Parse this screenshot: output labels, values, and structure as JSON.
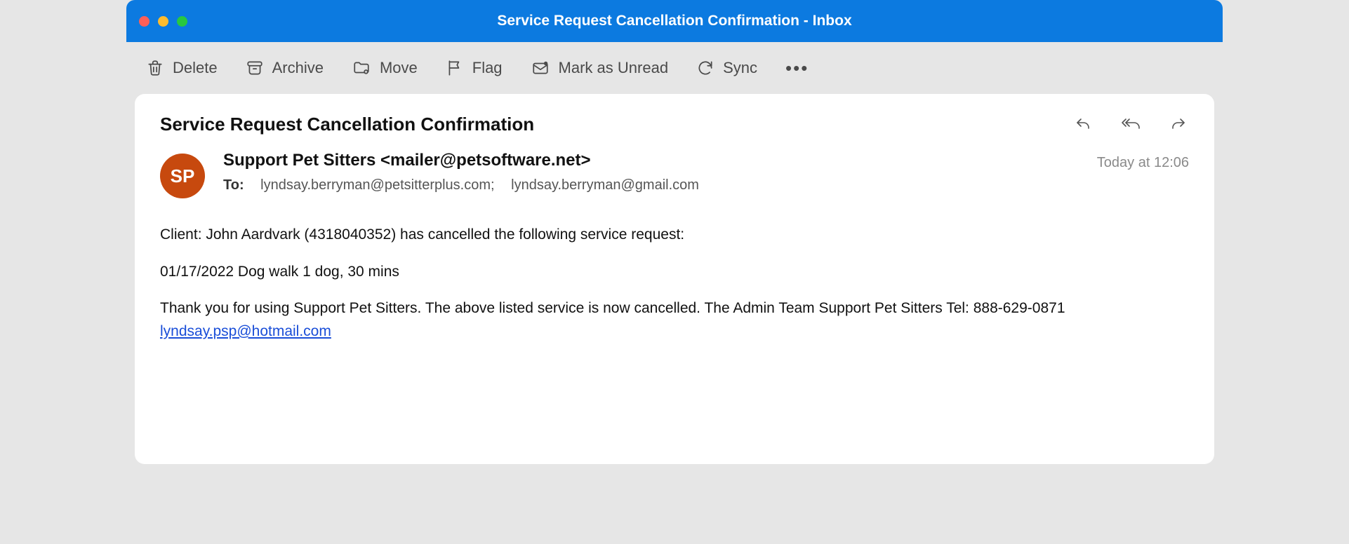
{
  "window": {
    "title": "Service Request Cancellation Confirmation - Inbox"
  },
  "toolbar": {
    "delete": "Delete",
    "archive": "Archive",
    "move": "Move",
    "flag": "Flag",
    "mark_unread": "Mark as Unread",
    "sync": "Sync"
  },
  "message": {
    "subject": "Service Request Cancellation Confirmation",
    "sender_display": "Support Pet Sitters <mailer@petsoftware.net>",
    "avatar_initials": "SP",
    "to_label": "To:",
    "recipients": [
      "lyndsay.berryman@petsitterplus.com;",
      "lyndsay.berryman@gmail.com"
    ],
    "timestamp": "Today at 12:06",
    "body": {
      "line1": "Client: John Aardvark (4318040352) has cancelled the following service request:",
      "line2": "01/17/2022 Dog walk 1 dog, 30 mins",
      "line3_text": "Thank you for using Support Pet Sitters. The above listed service is now cancelled. The Admin Team Support Pet Sitters Tel: 888-629-0871 ",
      "link_text": "lyndsay.psp@hotmail.com"
    }
  }
}
